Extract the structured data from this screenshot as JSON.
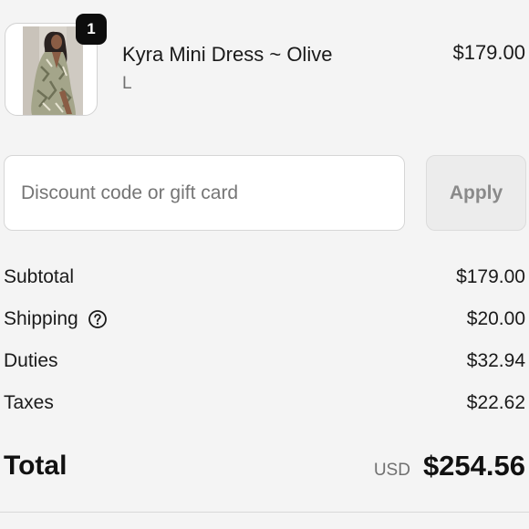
{
  "product": {
    "name": "Kyra Mini Dress ~ Olive",
    "variant": "L",
    "price": "$179.00",
    "quantity": "1",
    "image": "product-photo-model-olive-dress"
  },
  "discount": {
    "placeholder": "Discount code or gift card",
    "value": "",
    "apply_label": "Apply"
  },
  "summary": {
    "subtotal_label": "Subtotal",
    "subtotal_value": "$179.00",
    "shipping_label": "Shipping",
    "shipping_value": "$20.00",
    "shipping_icon": "question-circle-icon",
    "duties_label": "Duties",
    "duties_value": "$32.94",
    "taxes_label": "Taxes",
    "taxes_value": "$22.62"
  },
  "total": {
    "label": "Total",
    "currency": "USD",
    "amount": "$254.56"
  }
}
